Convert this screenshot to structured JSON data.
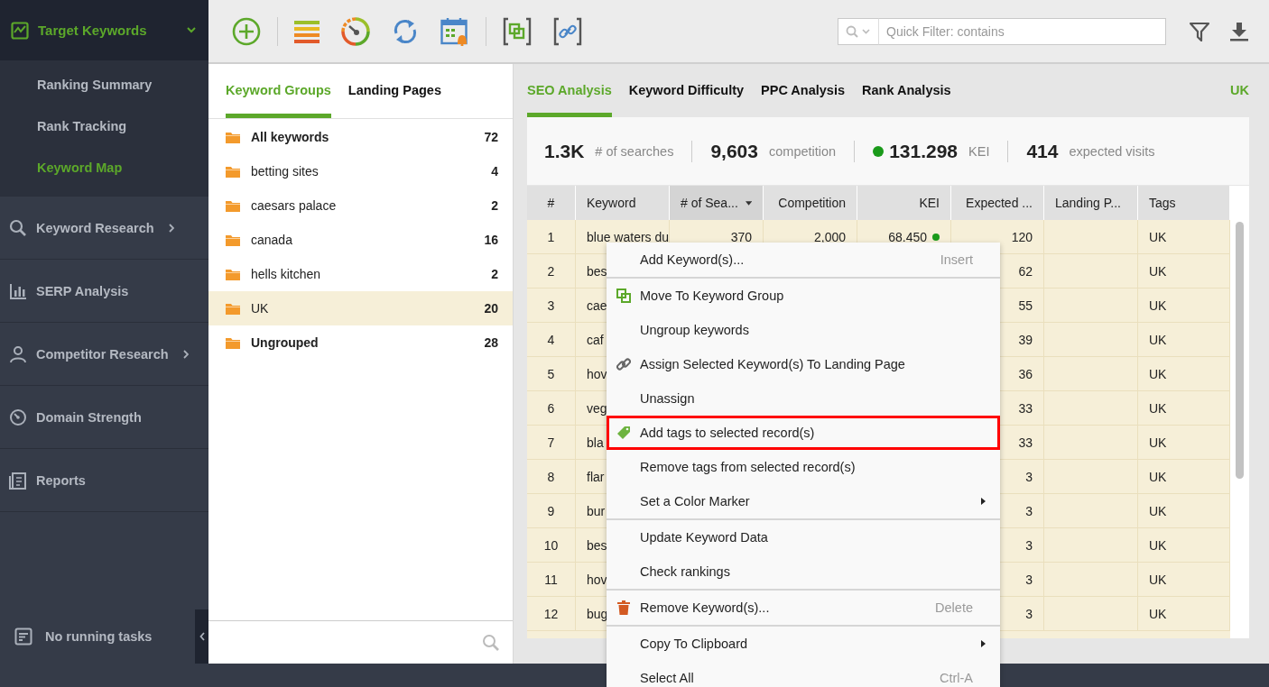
{
  "sidebar": {
    "header": {
      "label": "Target Keywords",
      "expanded": true
    },
    "subitems": [
      {
        "label": "Ranking Summary",
        "selected": false
      },
      {
        "label": "Rank Tracking",
        "selected": false
      },
      {
        "label": "Keyword Map",
        "selected": true
      }
    ],
    "sections": [
      {
        "label": "Keyword Research",
        "has_submenu": true
      },
      {
        "label": "SERP Analysis",
        "has_submenu": false
      },
      {
        "label": "Competitor Research",
        "has_submenu": true
      },
      {
        "label": "Domain Strength",
        "has_submenu": false
      },
      {
        "label": "Reports",
        "has_submenu": false
      }
    ],
    "tasks": "No running tasks"
  },
  "toolbar": {
    "search": {
      "placeholder": "Quick Filter: contains"
    }
  },
  "groups_panel": {
    "tabs": [
      {
        "label": "Keyword Groups",
        "selected": true
      },
      {
        "label": "Landing Pages",
        "selected": false
      }
    ],
    "groups": [
      {
        "name": "All keywords",
        "count": "72",
        "kind": "total",
        "selected": false
      },
      {
        "name": "betting sites",
        "count": "4",
        "kind": "group",
        "selected": false
      },
      {
        "name": "caesars palace",
        "count": "2",
        "kind": "group",
        "selected": false
      },
      {
        "name": "canada",
        "count": "16",
        "kind": "group",
        "selected": false
      },
      {
        "name": "hells kitchen",
        "count": "2",
        "kind": "group",
        "selected": false
      },
      {
        "name": "UK",
        "count": "20",
        "kind": "group",
        "selected": true
      },
      {
        "name": "Ungrouped",
        "count": "28",
        "kind": "total",
        "selected": false
      }
    ]
  },
  "analysis": {
    "tabs": [
      {
        "label": "SEO Analysis",
        "selected": true
      },
      {
        "label": "Keyword Difficulty",
        "selected": false
      },
      {
        "label": "PPC Analysis",
        "selected": false
      },
      {
        "label": "Rank Analysis",
        "selected": false
      }
    ],
    "region": "UK",
    "summary": [
      {
        "value": "1.3K",
        "label": "# of searches"
      },
      {
        "value": "9,603",
        "label": "competition"
      },
      {
        "value": "131.298",
        "label": "KEI",
        "color": "#1a9a1a"
      },
      {
        "value": "414",
        "label": "expected visits"
      }
    ]
  },
  "table": {
    "columns": [
      {
        "label": "#",
        "sorted": false
      },
      {
        "label": "Keyword",
        "sorted": false
      },
      {
        "label": "# of Sea...",
        "sorted": true
      },
      {
        "label": "Competition",
        "sorted": false
      },
      {
        "label": "KEI",
        "sorted": false
      },
      {
        "label": "Expected ...",
        "sorted": false
      },
      {
        "label": "Landing P...",
        "sorted": false
      },
      {
        "label": "Tags",
        "sorted": false
      }
    ],
    "rows": [
      {
        "num": "1",
        "keyword": "blue waters du",
        "searches": "370",
        "competition": "2,000",
        "kei": "68.450",
        "kei_dot": true,
        "expected": "120",
        "tags": "UK",
        "selected": true
      },
      {
        "num": "2",
        "keyword": "bes",
        "expected": "62",
        "tags": "UK",
        "selected": true
      },
      {
        "num": "3",
        "keyword": "cae",
        "expected": "55",
        "tags": "UK",
        "selected": true
      },
      {
        "num": "4",
        "keyword": "caf",
        "expected": "39",
        "tags": "UK",
        "selected": true
      },
      {
        "num": "5",
        "keyword": "hov",
        "expected": "36",
        "tags": "UK",
        "selected": true
      },
      {
        "num": "6",
        "keyword": "veg",
        "expected": "33",
        "tags": "UK",
        "selected": true
      },
      {
        "num": "7",
        "keyword": "bla",
        "expected": "33",
        "tags": "UK",
        "selected": true
      },
      {
        "num": "8",
        "keyword": "flar",
        "expected": "3",
        "tags": "UK",
        "selected": true
      },
      {
        "num": "9",
        "keyword": "bur",
        "expected": "3",
        "tags": "UK",
        "selected": true
      },
      {
        "num": "10",
        "keyword": "bes",
        "expected": "3",
        "tags": "UK",
        "selected": true
      },
      {
        "num": "11",
        "keyword": "hov",
        "expected": "3",
        "tags": "UK",
        "selected": true
      },
      {
        "num": "12",
        "keyword": "bug",
        "expected": "3",
        "tags": "UK",
        "selected": true
      }
    ]
  },
  "context_menu": [
    {
      "kind": "item",
      "label": "Add Keyword(s)...",
      "shortcut": "Insert",
      "submenu": false,
      "highlighted": false
    },
    {
      "kind": "separator"
    },
    {
      "kind": "move",
      "label": "Move To Keyword Group",
      "submenu": false,
      "highlighted": false
    },
    {
      "kind": "item",
      "label": "Ungroup keywords",
      "submenu": false,
      "highlighted": false
    },
    {
      "kind": "link",
      "label": "Assign Selected Keyword(s) To Landing Page",
      "submenu": false,
      "highlighted": false
    },
    {
      "kind": "item",
      "label": "Unassign",
      "submenu": false,
      "highlighted": false
    },
    {
      "kind": "tag",
      "label": "Add tags to selected record(s)",
      "submenu": false,
      "highlighted": true
    },
    {
      "kind": "item",
      "label": "Remove tags from selected record(s)",
      "submenu": false,
      "highlighted": false
    },
    {
      "kind": "item",
      "label": "Set a Color Marker",
      "submenu": true,
      "highlighted": false
    },
    {
      "kind": "separator"
    },
    {
      "kind": "item",
      "label": "Update Keyword Data",
      "submenu": false,
      "highlighted": false
    },
    {
      "kind": "item",
      "label": "Check rankings",
      "submenu": false,
      "highlighted": false
    },
    {
      "kind": "separator"
    },
    {
      "kind": "trash",
      "label": "Remove Keyword(s)...",
      "shortcut": "Delete",
      "submenu": false,
      "highlighted": false
    },
    {
      "kind": "separator"
    },
    {
      "kind": "item",
      "label": "Copy To Clipboard",
      "submenu": true,
      "highlighted": false
    },
    {
      "kind": "item",
      "label": "Select All",
      "shortcut": "Ctrl-A",
      "submenu": false,
      "highlighted": false
    }
  ]
}
